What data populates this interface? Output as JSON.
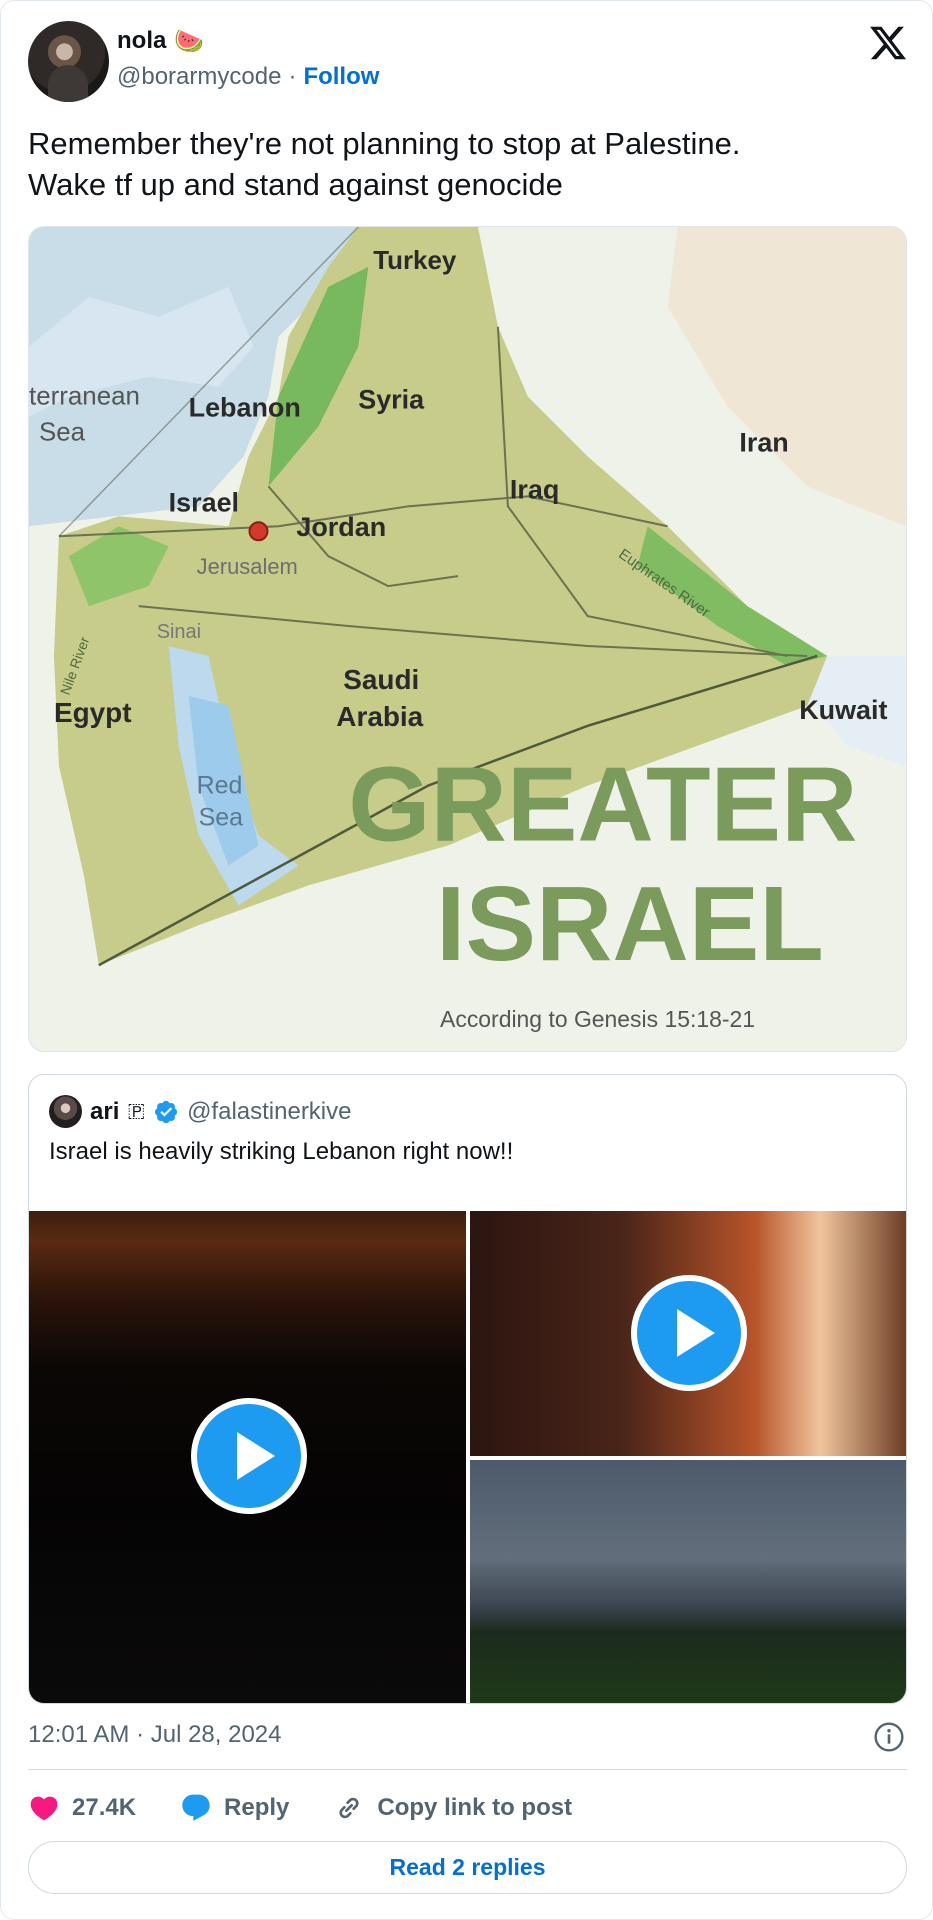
{
  "author": {
    "name": "nola",
    "emoji": "🍉",
    "handle": "@borarmycode",
    "separator": "·",
    "follow_label": "Follow"
  },
  "tweet": {
    "text_line1": "Remember they're not planning to stop at Palestine.",
    "text_line2": "Wake tf up and stand against genocide"
  },
  "map_image": {
    "labels": {
      "turkey": "Turkey",
      "sea_line1": "terranean",
      "sea_line2": "Sea",
      "lebanon": "Lebanon",
      "syria": "Syria",
      "iran": "Iran",
      "israel": "Israel",
      "iraq": "Iraq",
      "jordan": "Jordan",
      "jerusalem": "Jerusalem",
      "euphrates": "Euphrates River",
      "nile": "Nile River",
      "sinai": "Sinai",
      "saudi_line1": "Saudi",
      "saudi_line2": "Arabia",
      "egypt": "Egypt",
      "kuwait": "Kuwait",
      "red_line1": "Red",
      "red_line2": "Sea",
      "title_line1": "GREATER",
      "title_line2": "ISRAEL",
      "caption": "According to Genesis 15:18-21"
    }
  },
  "quote": {
    "name": "ari",
    "name_suffix": "🇵",
    "handle": "@falastinerkive",
    "text": "Israel is heavily striking Lebanon right now!!"
  },
  "meta": {
    "timestamp": "12:01 AM · Jul 28, 2024"
  },
  "actions": {
    "likes": "27.4K",
    "reply": "Reply",
    "copy": "Copy link to post"
  },
  "read_replies": "Read 2 replies",
  "colors": {
    "link": "#006fd6",
    "verified": "#1d9bf0",
    "like": "#f91880",
    "reply": "#1d9bf0"
  }
}
